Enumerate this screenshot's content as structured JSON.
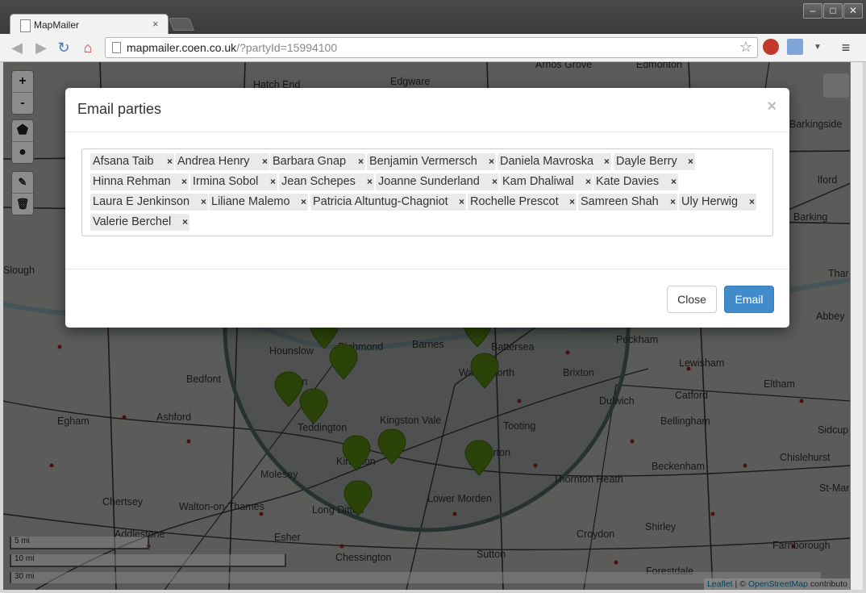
{
  "browser": {
    "tab_title": "MapMailer",
    "tab_close": "×",
    "url_host": "mapmailer.coen.co.uk",
    "url_path": "/?partyId=15994100"
  },
  "map": {
    "labels": [
      "Arnos Grove",
      "Edmonton",
      "Edgware",
      "Hatch End",
      "Barkingside",
      "Barking",
      "Slough",
      "Hounslow",
      "Barnes",
      "Battersea",
      "Peckham",
      "Brixton",
      "Lewisham",
      "Eltham",
      "Bedfont",
      "Richmond",
      "Wandsworth",
      "Dulwich",
      "Catford",
      "Egham",
      "Ashford",
      "Teddington",
      "Kingston Vale",
      "Tooting",
      "Bellingham",
      "Sidcup",
      "Kingston",
      "Merton",
      "Beckenham",
      "Chislehurst",
      "Molesey",
      "Thornton Heath",
      "Chertsey",
      "Walton-on-Thames",
      "Long Ditton",
      "Lower Morden",
      "Shirley",
      "St-Mar",
      "Addlestone",
      "Esher",
      "Croydon",
      "Farnborough",
      "Chessington",
      "Sutton",
      "Forestdale",
      "Abbey",
      "Thar",
      "lford",
      "ton"
    ],
    "zoom_in": "+",
    "zoom_out": "-",
    "scale": [
      "5 mi",
      "10 mi",
      "30 mi"
    ],
    "attribution": {
      "leaflet": "Leaflet",
      "sep": " | © ",
      "osm": "OpenStreetMap",
      "contrib": " contributo"
    }
  },
  "modal": {
    "title": "Email parties",
    "close_x": "×",
    "tags": [
      "Afsana Taib",
      "Andrea Henry",
      "Barbara Gnap",
      "Benjamin Vermersch",
      "Daniela Mavroska",
      "Dayle Berry",
      "Hinna Rehman",
      "Irmina Sobol",
      "Jean Schepes",
      "Joanne Sunderland",
      "Kam Dhaliwal",
      "Kate Davies",
      "Laura E Jenkinson",
      "Liliane Malemo",
      "Patricia Altuntug-Chagniot",
      "Rochelle Prescot",
      "Samreen Shah",
      "Uly Herwig",
      "Valerie Berchel"
    ],
    "tag_remove": "×",
    "close_button": "Close",
    "email_button": "Email"
  },
  "colors": {
    "accent": "#428bca",
    "marker": "#4f7a12"
  }
}
